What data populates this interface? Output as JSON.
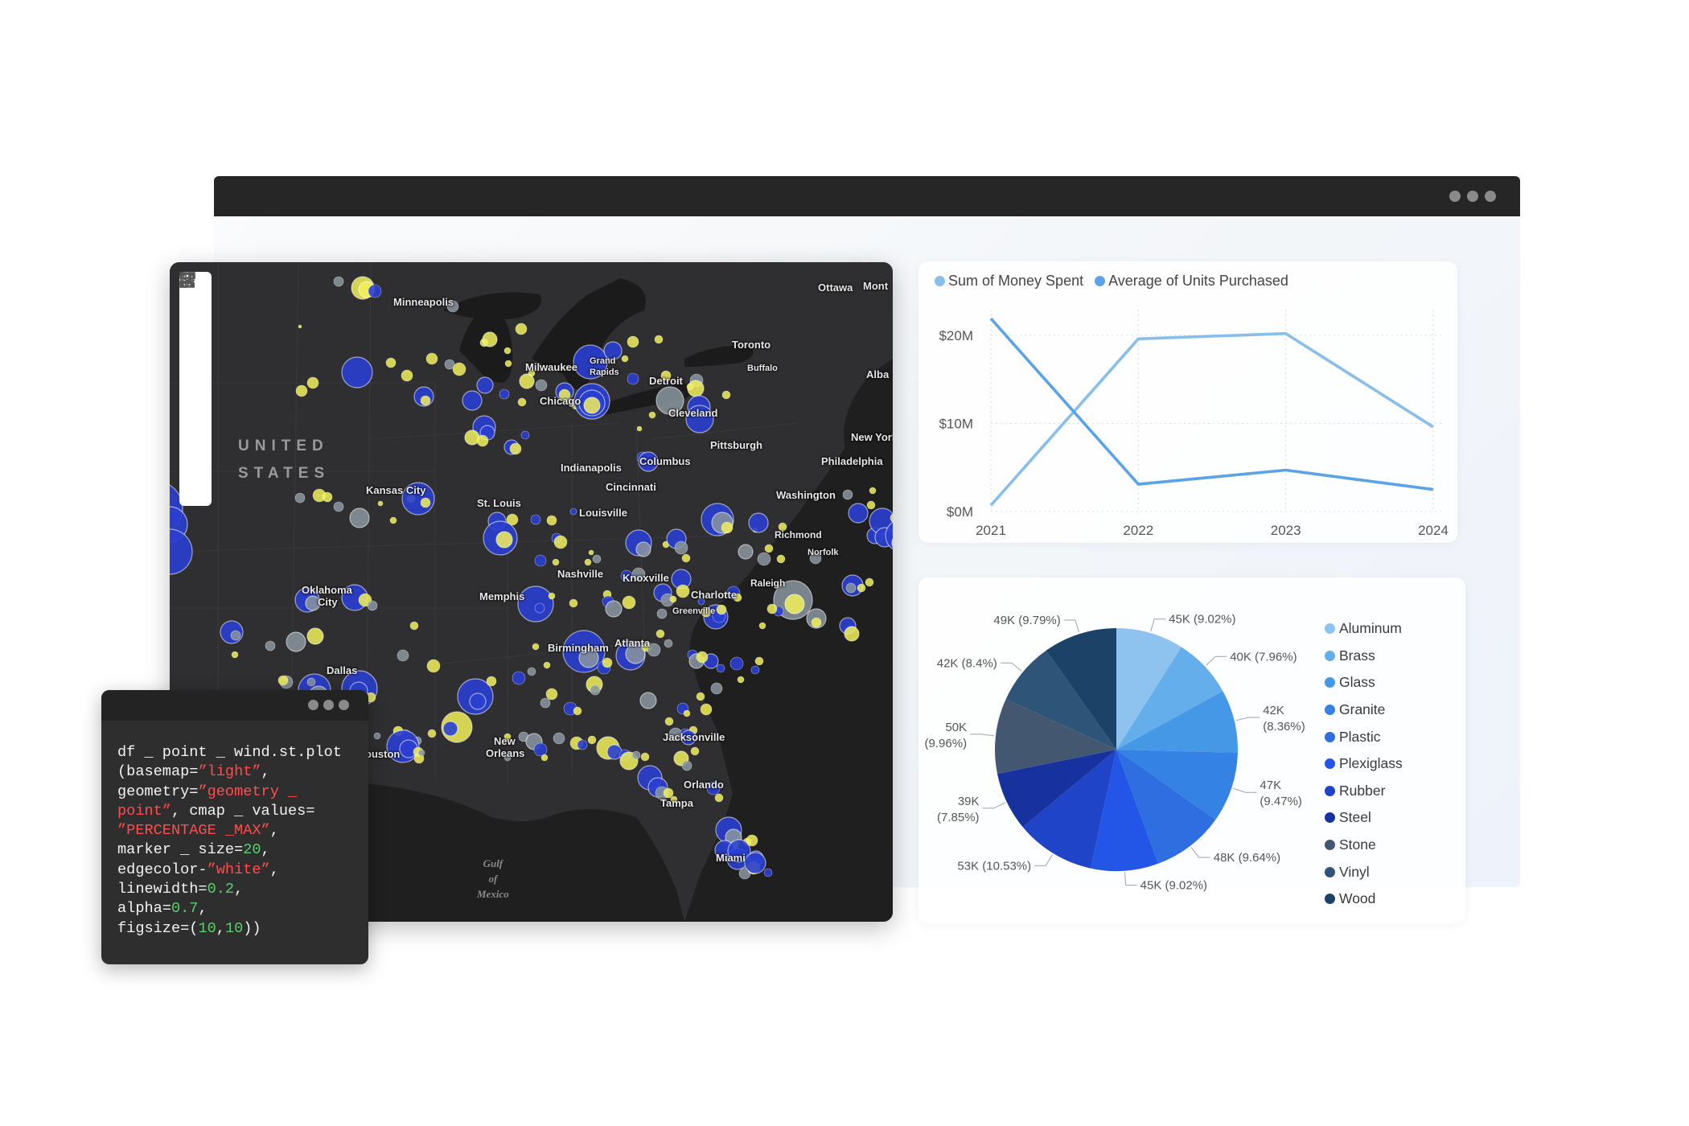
{
  "window": {
    "controls": [
      "•",
      "•",
      "•"
    ]
  },
  "map": {
    "country_lines": [
      "UNITED",
      "STATES"
    ],
    "gulf_lines": [
      "Gulf",
      "of",
      "Mexico"
    ],
    "colors": {
      "blue_marker": "#2a3fd0",
      "yellow_marker": "#f2f05a",
      "gray_marker": "#8a96a0"
    },
    "labels": {
      "minneapolis": "Minneapolis",
      "ottawa": "Ottawa",
      "montreal": "Mont",
      "toronto": "Toronto",
      "milwaukee": "Milwaukee",
      "grand_rapids_1": "Grand",
      "grand_rapids_2": "Rapids",
      "buffalo": "Buffalo",
      "detroit": "Detroit",
      "albany": "Alba",
      "chicago": "Chicago",
      "cleveland": "Cleveland",
      "new_york": "New York",
      "pittsburgh": "Pittsburgh",
      "philadelphia": "Philadelphia",
      "indianapolis": "Indianapolis",
      "columbus": "Columbus",
      "cincinnati": "Cincinnati",
      "kansas_city": "Kansas City",
      "st_louis": "St. Louis",
      "washington": "Washington",
      "louisville": "Louisville",
      "richmond": "Richmond",
      "norfolk": "Norfolk",
      "nashville": "Nashville",
      "knoxville": "Knoxville",
      "raleigh": "Raleigh",
      "oklahoma_1": "Oklahoma",
      "oklahoma_2": "City",
      "memphis": "Memphis",
      "charlotte": "Charlotte",
      "greenville": "Greenville",
      "birmingham": "Birmingham",
      "atlanta": "Atlanta",
      "dallas": "Dallas",
      "houston": "ouston",
      "new_orleans_1": "New",
      "new_orleans_2": "Orleans",
      "jacksonville": "Jacksonville",
      "orlando": "Orlando",
      "tampa": "Tampa",
      "miami": "Miami"
    },
    "toolbar": [
      "menu-icon",
      "layers-icon",
      "qr-icon",
      "select-box-icon",
      "search-icon",
      "chart-icon",
      "user-icon"
    ]
  },
  "code": {
    "controls": [
      "•",
      "•",
      "•"
    ],
    "tokens": {
      "l1": "df _ point _ wind.st.plot",
      "l2a": "(basemap=",
      "l2b": "”light”",
      "l2c": ",",
      "l3a": "geometry=",
      "l3b": "”geometry _",
      "l4a": "point”",
      "l4b": ", cmap _ values=",
      "l5a": "”PERCENTAGE _MAX”",
      "l5b": ",",
      "l6a": "marker _ size=",
      "l6b": "20",
      "l6c": ",",
      "l7a": "edgecolor-",
      "l7b": "”white”",
      "l7c": ",",
      "l8a": "linewidth=",
      "l8b": "0.2",
      "l8c": ",",
      "l9a": "alpha=",
      "l9b": "0.7",
      "l9c": ",",
      "l10a": "figsize=(",
      "l10b": "10",
      "l10c": ",",
      "l10d": "10",
      "l10e": "))"
    }
  },
  "chart_data": [
    {
      "type": "line",
      "x": [
        "2021",
        "2022",
        "2023",
        "2024"
      ],
      "series": [
        {
          "name": "Sum of Money Spent",
          "values": [
            0.7,
            19.6,
            20.2,
            9.6
          ],
          "color": "#88bfea"
        },
        {
          "name": "Average of Units Purchased",
          "values": [
            21.9,
            3.1,
            4.7,
            2.5
          ],
          "color": "#5aa3e6"
        }
      ],
      "yticks": [
        "$0M",
        "$10M",
        "$20M"
      ],
      "ytick_values": [
        0,
        10,
        20
      ],
      "ylim": [
        0,
        22
      ],
      "grid": true,
      "legend_position": "top-left"
    },
    {
      "type": "pie",
      "slices": [
        {
          "name": "Aluminum",
          "value": 45,
          "label": "45K (9.02%)",
          "color": "#8ec3f0"
        },
        {
          "name": "Brass",
          "value": 40,
          "label": "40K (7.96%)",
          "color": "#63aeeb"
        },
        {
          "name": "Glass",
          "value": 42,
          "label_1": "42K",
          "label_2": "(8.36%)",
          "color": "#4498e6"
        },
        {
          "name": "Granite",
          "value": 47,
          "label_1": "47K",
          "label_2": "(9.47%)",
          "color": "#3482e3"
        },
        {
          "name": "Plastic",
          "value": 48,
          "label": "48K (9.64%)",
          "color": "#2e6ee0"
        },
        {
          "name": "Plexiglass",
          "value": 45,
          "label": "45K (9.02%)",
          "color": "#2356e6"
        },
        {
          "name": "Rubber",
          "value": 53,
          "label": "53K (10.53%)",
          "color": "#1f44c8"
        },
        {
          "name": "Steel",
          "value": 39,
          "label_1": "39K",
          "label_2": "(7.85%)",
          "color": "#17329e"
        },
        {
          "name": "Stone",
          "value": 50,
          "label_1": "50K",
          "label_2": "(9.96%)",
          "color": "#435870"
        },
        {
          "name": "Vinyl",
          "value": 42,
          "label": "42K (8.4%)",
          "color": "#2e5478"
        },
        {
          "name": "Wood",
          "value": 49,
          "label": "49K (9.79%)",
          "color": "#1c4268"
        }
      ],
      "legend_position": "right"
    }
  ]
}
